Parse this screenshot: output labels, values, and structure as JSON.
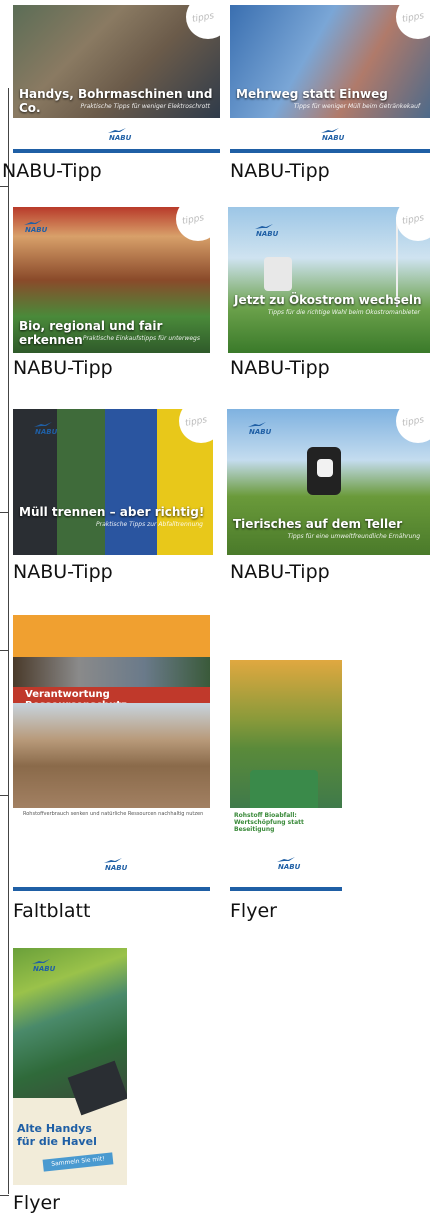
{
  "cards": [
    {
      "caption": "NABU-Tipp",
      "title": "Handys, Bohrmaschinen und Co.",
      "subtitle": "Praktische Tipps für weniger Elektroschrott"
    },
    {
      "caption": "NABU-Tipp",
      "title": "Mehrweg statt Einweg",
      "subtitle": "Tipps für weniger Müll beim Getränkekauf"
    },
    {
      "caption": "NABU-Tipp",
      "title": "Bio, regional und fair erkennen",
      "subtitle": "Praktische Einkaufstipps für unterwegs"
    },
    {
      "caption": "NABU-Tipp",
      "title": "Jetzt zu Ökostrom wechseln",
      "subtitle": "Tipps für die richtige Wahl beim Ökostromanbieter"
    },
    {
      "caption": "NABU-Tipp",
      "title": "Müll trennen – aber richtig!",
      "subtitle": "Praktische Tipps zur Abfalltrennung"
    },
    {
      "caption": "NABU-Tipp",
      "title": "Tierisches auf dem Teller",
      "subtitle": "Tipps für eine umweltfreundliche Ernährung"
    },
    {
      "caption": "Faltblatt",
      "title": "Verantwortung Ressourcenschutz",
      "subtitle": "Rohstoffverbrauch senken und natürliche Ressourcen nachhaltig nutzen"
    },
    {
      "caption": "Flyer",
      "title": "Rohstoff Bioabfall: Wertschöpfung statt Beseitigung",
      "subtitle": ""
    },
    {
      "caption": "Flyer",
      "title": "Alte Handys für die Havel",
      "subtitle": "Sammeln Sie mit!"
    }
  ],
  "logo_text": "NABU",
  "badge_text": "tipps",
  "colors": {
    "nabu_blue": "#1f5fa5",
    "orange": "#f0a030",
    "red_banner": "#c0392b"
  }
}
